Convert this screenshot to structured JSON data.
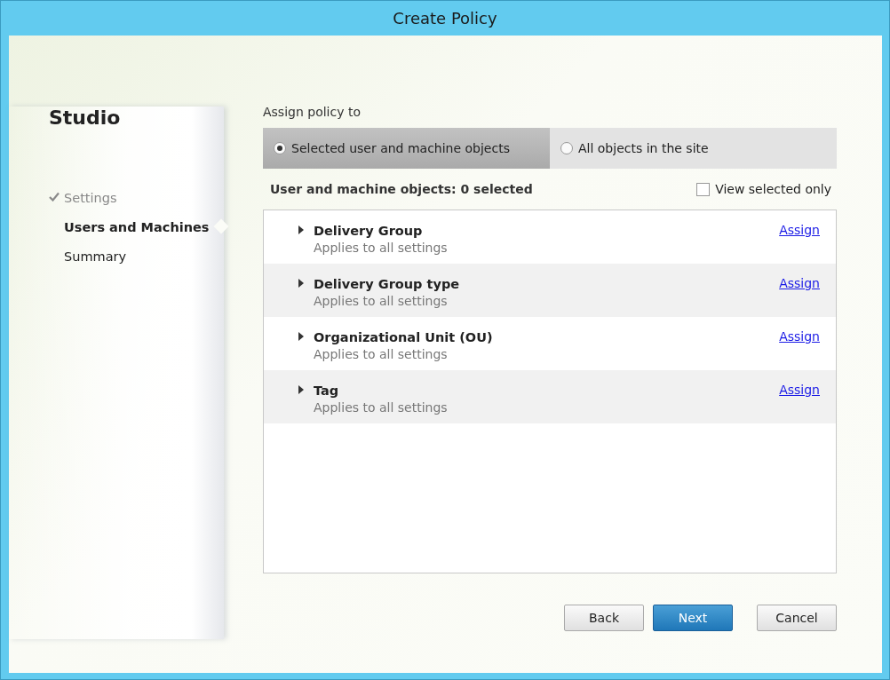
{
  "window": {
    "title": "Create Policy"
  },
  "sidebar": {
    "title": "Studio",
    "steps": [
      {
        "label": "Settings",
        "completed": true,
        "selected": false
      },
      {
        "label": "Users and Machines",
        "completed": false,
        "selected": true
      },
      {
        "label": "Summary",
        "completed": false,
        "selected": false
      }
    ]
  },
  "assign_section": {
    "label": "Assign policy to",
    "options": [
      {
        "label": "Selected user and machine objects",
        "selected": true
      },
      {
        "label": "All objects in the site",
        "selected": false
      }
    ]
  },
  "objects": {
    "heading": "User and machine objects: 0 selected",
    "view_selected_only": {
      "label": "View selected only",
      "checked": false
    },
    "rows": [
      {
        "name": "Delivery Group",
        "description": "Applies to all settings",
        "expanded": false,
        "action": "Assign"
      },
      {
        "name": "Delivery Group type",
        "description": "Applies to all settings",
        "expanded": false,
        "action": "Assign"
      },
      {
        "name": "Organizational Unit (OU)",
        "description": "Applies to all settings",
        "expanded": false,
        "action": "Assign"
      },
      {
        "name": "Tag",
        "description": "Applies to all settings",
        "expanded": false,
        "action": "Assign"
      }
    ]
  },
  "buttons": [
    {
      "label": "Back",
      "kind": "normal"
    },
    {
      "label": "Next",
      "kind": "primary"
    },
    {
      "label": "Cancel",
      "kind": "normal"
    }
  ]
}
